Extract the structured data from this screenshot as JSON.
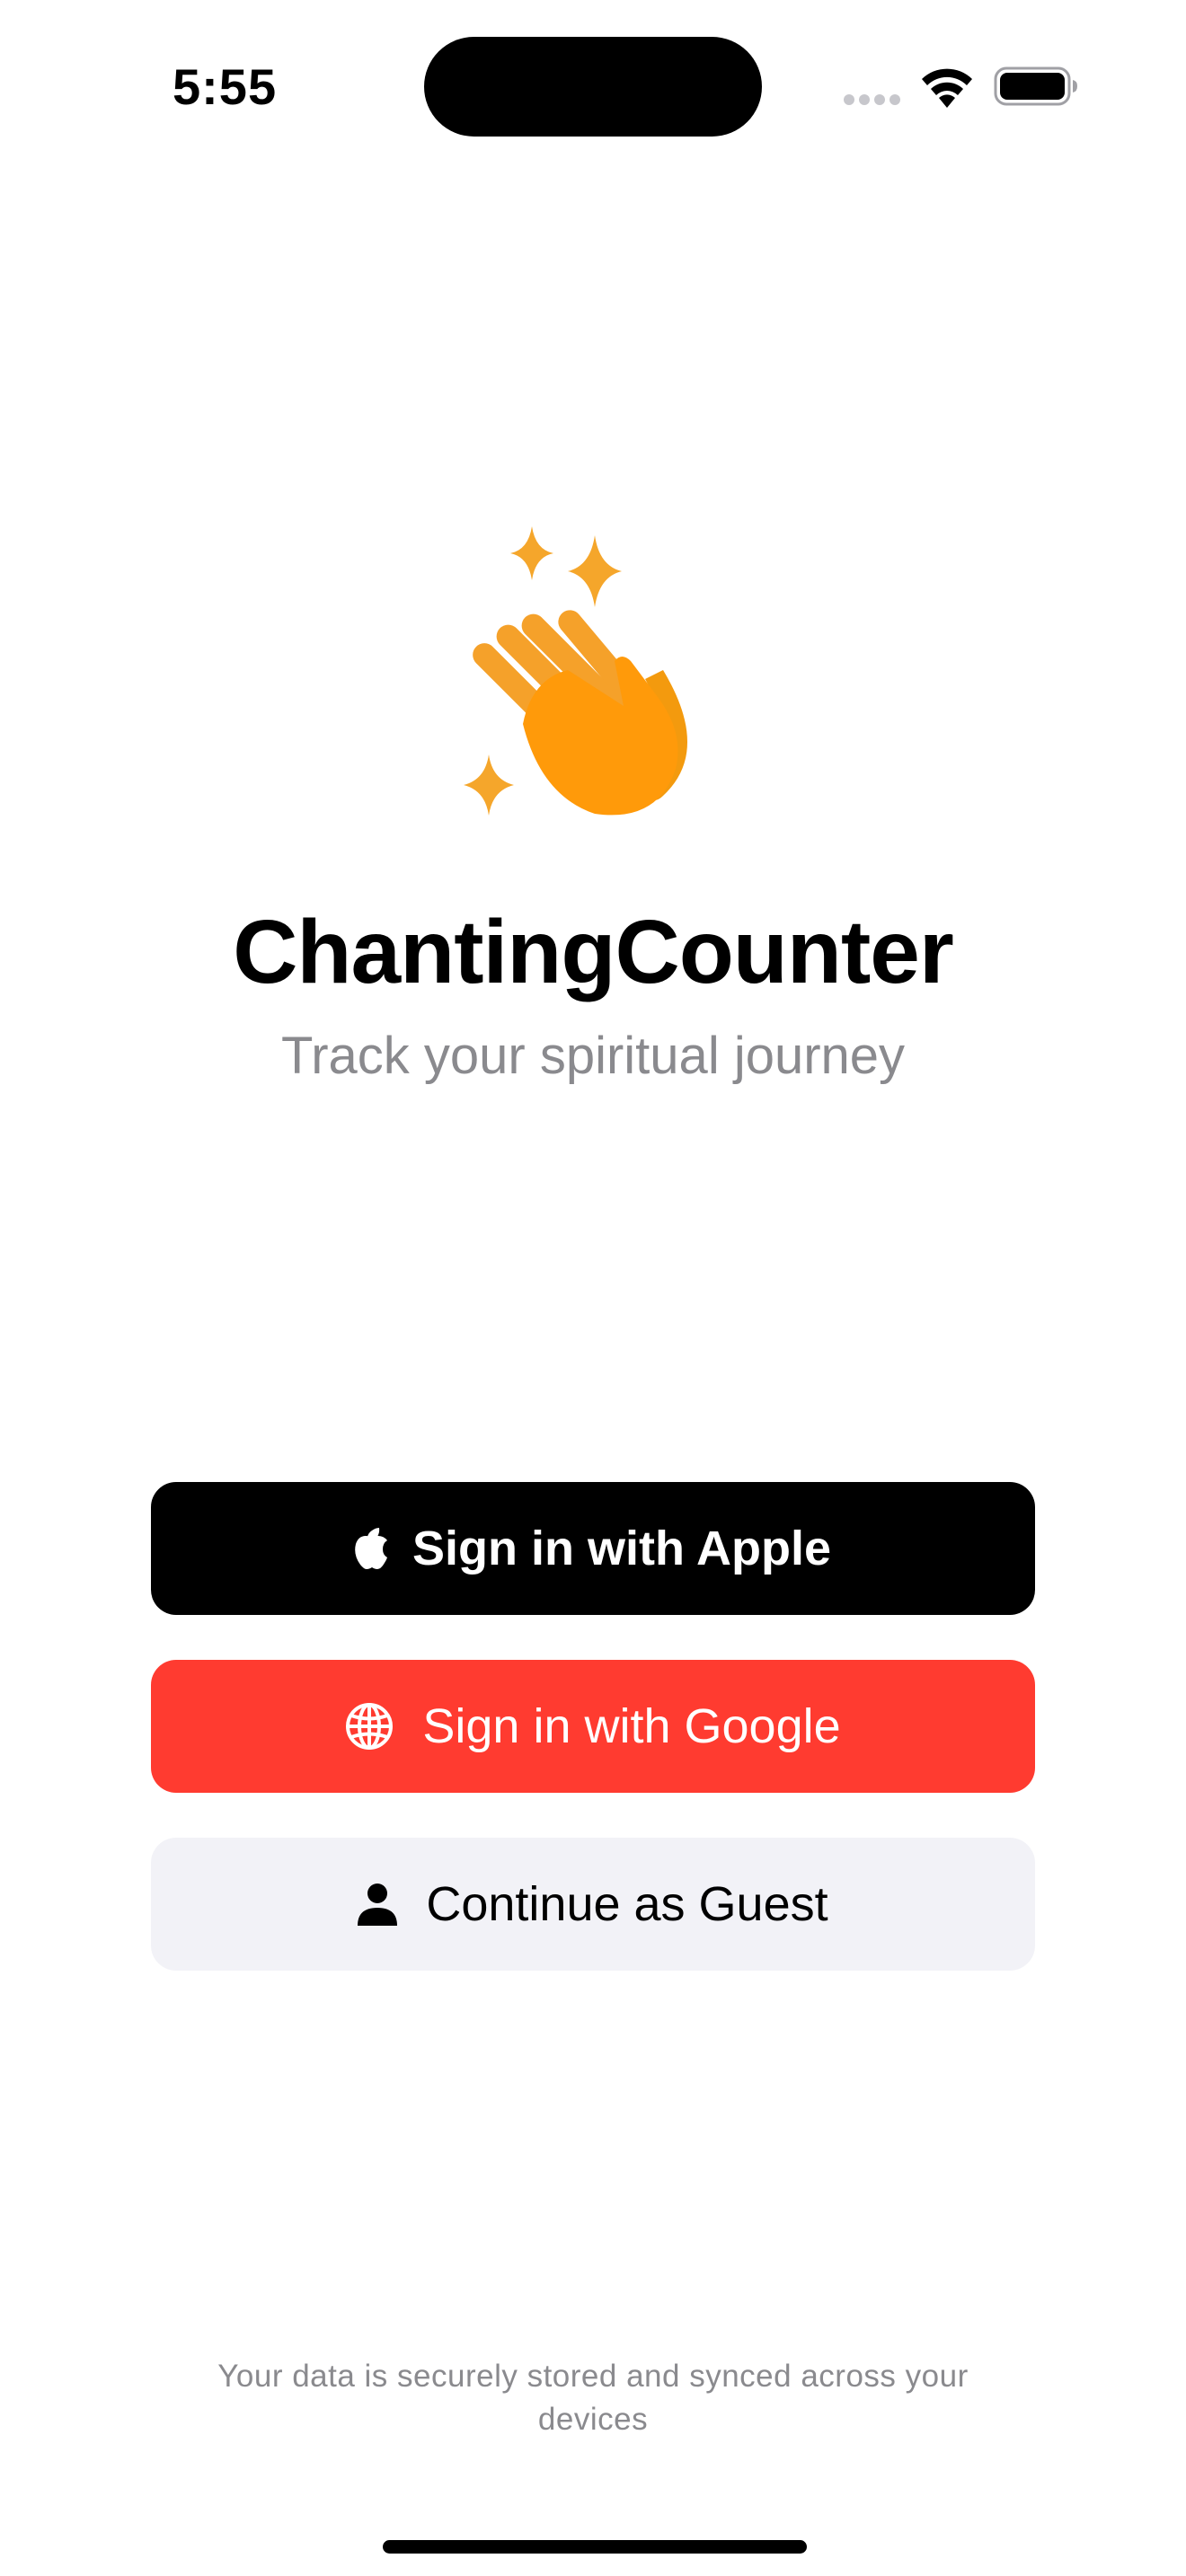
{
  "status_bar": {
    "time": "5:55"
  },
  "app": {
    "title": "ChantingCounter",
    "subtitle": "Track your spiritual journey",
    "logo_icon": "hands-clapping-sparkles-icon",
    "accent_color": "#FF9F0A"
  },
  "auth": {
    "apple_label": "Sign in with Apple",
    "apple_icon": "apple-logo-icon",
    "google_label": "Sign in with Google",
    "google_icon": "globe-icon",
    "google_color": "#FF3B30",
    "guest_label": "Continue as Guest",
    "guest_icon": "person-icon"
  },
  "footer": {
    "note": "Your data is securely stored and synced across your devices"
  }
}
